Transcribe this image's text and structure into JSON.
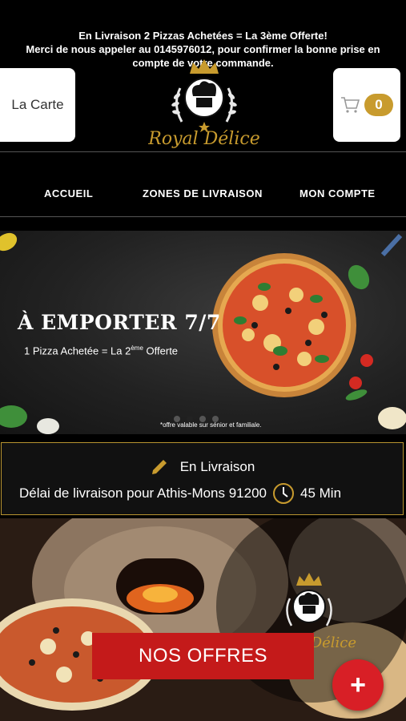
{
  "promo": {
    "line1": "En Livraison 2 Pizzas Achetées = La 3ème Offerte!",
    "line2": "Merci de nous appeler au 0145976012, pour confirmer la bonne prise en",
    "line3": "compte de votre commande."
  },
  "header": {
    "menu_button": "La Carte",
    "cart_count": "0",
    "brand": "Royal Délice"
  },
  "nav": {
    "items": [
      "ACCUEIL",
      "ZONES DE LIVRAISON",
      "MON COMPTE"
    ]
  },
  "banner": {
    "title": "À EMPORTER 7/7",
    "subtitle_pre": "1 Pizza Achetée = La 2",
    "subtitle_sup": "ème",
    "subtitle_post": " Offerte",
    "note": "*offre valable sur sénior et familiale.",
    "slide_count": 4,
    "active_slide": 1
  },
  "delivery": {
    "mode": "En Livraison",
    "delay_label": "Délai de livraison pour Athis-Mons 91200",
    "delay_value": "45 Min"
  },
  "offers": {
    "button": "NOS OFFRES",
    "brand": "Royal Délice"
  },
  "colors": {
    "gold": "#c89b2e",
    "red": "#c41a1a",
    "fab": "#d81f26"
  }
}
